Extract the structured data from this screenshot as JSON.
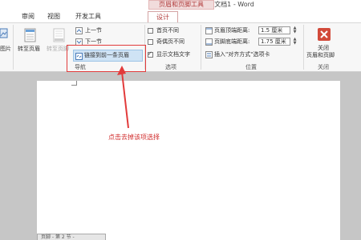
{
  "window": {
    "context_tab_group": "页眉和页脚工具",
    "title": "文档1 - Word"
  },
  "tabs": [
    {
      "label": "审阅"
    },
    {
      "label": "视图"
    },
    {
      "label": "开发工具"
    },
    {
      "label": "设计"
    }
  ],
  "ribbon": {
    "left_partial": "图片",
    "nav": {
      "goto_header": "转至页眉",
      "goto_footer": "转至页脚",
      "previous": "上一节",
      "next": "下一节",
      "link_previous": "链接到前一条页眉",
      "group_label": "导航"
    },
    "options": {
      "diff_first_page": "首页不同",
      "diff_odd_even": "奇偶页不同",
      "show_doc_text": "显示文档文字",
      "group_label": "选项",
      "diff_first_page_checked": false,
      "diff_odd_even_checked": false,
      "show_doc_text_checked": true
    },
    "position": {
      "header_from_top_label": "页眉顶端距离:",
      "header_from_top_value": "1.5 厘米",
      "footer_from_bottom_label": "页脚底端距离:",
      "footer_from_bottom_value": "1.75 厘米",
      "insert_align_tab": "插入\"对齐方式\"选项卡",
      "group_label": "位置"
    },
    "close": {
      "label_line1": "关闭",
      "label_line2": "页眉和页脚",
      "group_label": "关闭"
    }
  },
  "annotation": "点击去掉该项选择",
  "footer_tag": "页脚 - 第 2 节 -",
  "colors": {
    "accent": "#b13a3a",
    "highlight": "#e23b3b",
    "selected_button": "#cfe3f5"
  }
}
